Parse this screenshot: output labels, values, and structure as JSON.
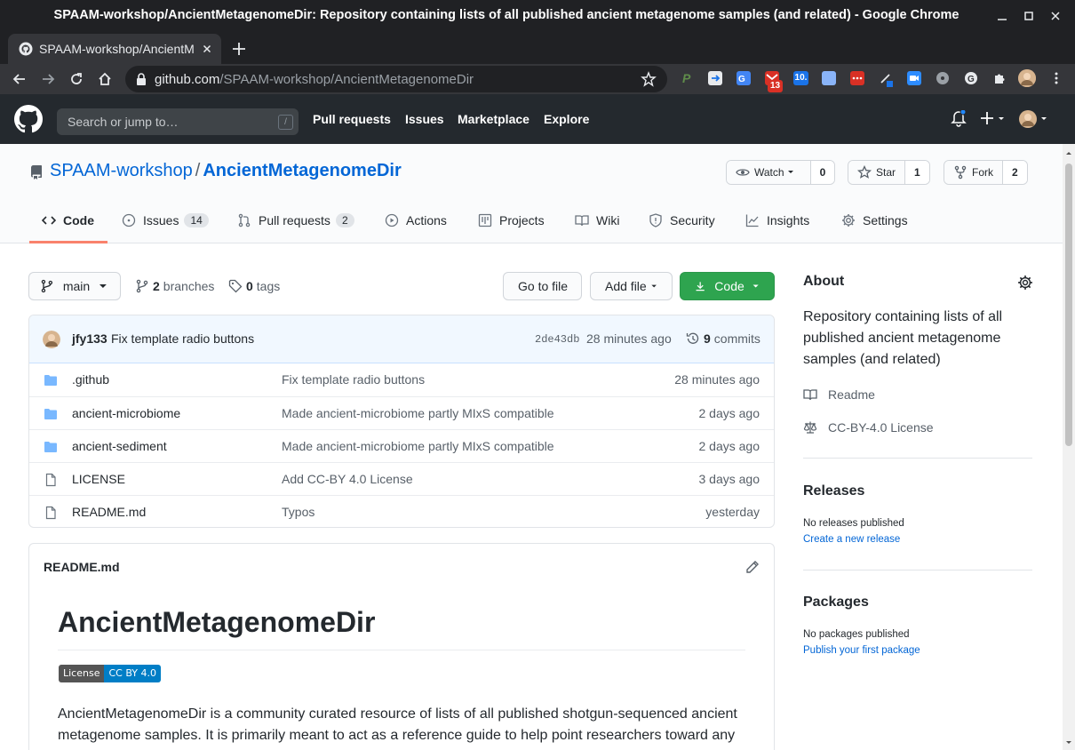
{
  "window": {
    "title": "SPAAM-workshop/AncientMetagenomeDir: Repository containing lists of all published ancient metagenome samples (and related) - Google Chrome"
  },
  "browser": {
    "tab_title": "SPAAM-workshop/AncientMetagenomeDir",
    "url_host": "github.com",
    "url_path": "/SPAAM-workshop/AncientMetagenomeDir",
    "ext_badge_count": "13",
    "ext_badge2": "10."
  },
  "github": {
    "search_placeholder": "Search or jump to…",
    "search_shortcut": "/",
    "nav": [
      "Pull requests",
      "Issues",
      "Marketplace",
      "Explore"
    ]
  },
  "repo": {
    "owner": "SPAAM-workshop",
    "separator": "/",
    "name": "AncientMetagenomeDir",
    "watch_label": "Watch",
    "watch_count": "0",
    "star_label": "Star",
    "star_count": "1",
    "fork_label": "Fork",
    "fork_count": "2",
    "tabs": [
      {
        "label": "Code",
        "count": ""
      },
      {
        "label": "Issues",
        "count": "14"
      },
      {
        "label": "Pull requests",
        "count": "2"
      },
      {
        "label": "Actions",
        "count": ""
      },
      {
        "label": "Projects",
        "count": ""
      },
      {
        "label": "Wiki",
        "count": ""
      },
      {
        "label": "Security",
        "count": ""
      },
      {
        "label": "Insights",
        "count": ""
      },
      {
        "label": "Settings",
        "count": ""
      }
    ]
  },
  "code": {
    "branch": "main",
    "branches_count": "2",
    "branches_label": "branches",
    "tags_count": "0",
    "tags_label": "tags",
    "goto_file": "Go to file",
    "add_file": "Add file",
    "code_button": "Code",
    "commit": {
      "author": "jfy133",
      "message": "Fix template radio buttons",
      "sha": "2de43db",
      "age": "28 minutes ago",
      "commits_count": "9",
      "commits_label": "commits"
    },
    "files": [
      {
        "name": ".github",
        "type": "dir",
        "message": "Fix template radio buttons",
        "age": "28 minutes ago"
      },
      {
        "name": "ancient-microbiome",
        "type": "dir",
        "message": "Made ancient-microbiome partly MIxS compatible",
        "age": "2 days ago"
      },
      {
        "name": "ancient-sediment",
        "type": "dir",
        "message": "Made ancient-microbiome partly MIxS compatible",
        "age": "2 days ago"
      },
      {
        "name": "LICENSE",
        "type": "file",
        "message": "Add CC-BY 4.0 License",
        "age": "3 days ago"
      },
      {
        "name": "README.md",
        "type": "file",
        "message": "Typos",
        "age": "yesterday"
      }
    ]
  },
  "readme": {
    "header": "README.md",
    "title": "AncientMetagenomeDir",
    "badge_left": "License",
    "badge_right": "CC BY 4.0",
    "paragraph": "AncientMetagenomeDir is a community curated resource of lists of all published shotgun-sequenced ancient metagenome samples. It is primarily meant to act as a reference guide to help point researchers toward any"
  },
  "sidebar": {
    "about_title": "About",
    "description": "Repository containing lists of all published ancient metagenome samples (and related)",
    "readme_link": "Readme",
    "license_link": "CC-BY-4.0 License",
    "releases_title": "Releases",
    "releases_none": "No releases published",
    "releases_create": "Create a new release",
    "packages_title": "Packages",
    "packages_none": "No packages published",
    "packages_publish": "Publish your first package"
  },
  "colors": {
    "accent_blue": "#0366d6",
    "green_button": "#2ea44f",
    "tab_underline": "#f9826c",
    "header_dark": "#24292e"
  }
}
